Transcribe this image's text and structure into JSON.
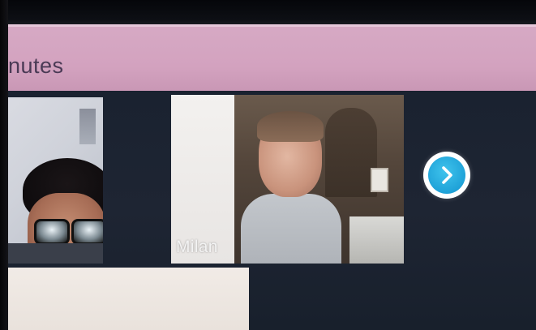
{
  "header": {
    "title": "nutes"
  },
  "participants": [
    {
      "name": ""
    },
    {
      "name": "Milan"
    }
  ],
  "navigation": {
    "next_icon": "chevron-right-icon"
  },
  "colors": {
    "header_background": "#d3a2bf",
    "stage_background": "#1e2533",
    "accent": "#1fa2d8"
  }
}
